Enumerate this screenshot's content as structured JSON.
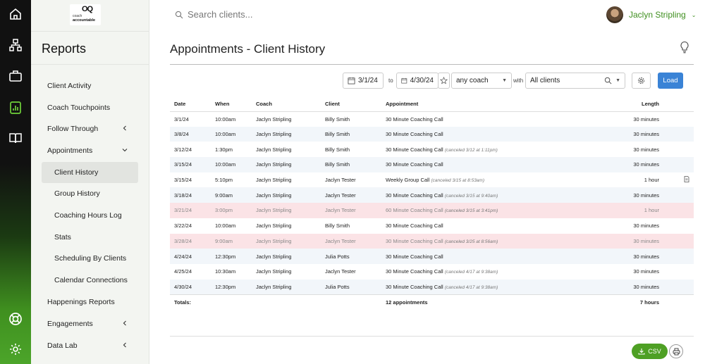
{
  "rail": {
    "icons": [
      "home-icon",
      "sitemap-icon",
      "briefcase-icon",
      "report-icon",
      "book-icon",
      "lifebuoy-icon",
      "gear-icon"
    ]
  },
  "logo": {
    "mark": "OQ",
    "line1": "coach",
    "line2": "accountable"
  },
  "sidebar": {
    "title": "Reports",
    "items": [
      {
        "label": "Client Activity"
      },
      {
        "label": "Coach Touchpoints"
      },
      {
        "label": "Follow Through"
      },
      {
        "label": "Appointments"
      },
      {
        "label": "Client History"
      },
      {
        "label": "Group History"
      },
      {
        "label": "Coaching Hours Log"
      },
      {
        "label": "Stats"
      },
      {
        "label": "Scheduling By Clients"
      },
      {
        "label": "Calendar Connections"
      },
      {
        "label": "Happenings Reports"
      },
      {
        "label": "Engagements"
      },
      {
        "label": "Data Lab"
      }
    ]
  },
  "header": {
    "search_placeholder": "Search clients...",
    "user_name": "Jaclyn Stripling"
  },
  "page_title": "Appointments - Client History",
  "filters": {
    "start_date": "3/1/24",
    "to_label": "to",
    "end_date": "4/30/24",
    "coach": "any coach",
    "with_label": "with",
    "clients": "All clients",
    "load_label": "Load"
  },
  "table": {
    "headers": [
      "Date",
      "When",
      "Coach",
      "Client",
      "Appointment",
      "Length"
    ],
    "rows": [
      {
        "date": "3/1/24",
        "when": "10:00am",
        "coach": "Jaclyn Stripling",
        "client": "Billy Smith",
        "appt": "30 Minute Coaching Call",
        "note": "",
        "length": "30 minutes"
      },
      {
        "date": "3/8/24",
        "when": "10:00am",
        "coach": "Jaclyn Stripling",
        "client": "Billy Smith",
        "appt": "30 Minute Coaching Call",
        "note": "",
        "length": "30 minutes"
      },
      {
        "date": "3/12/24",
        "when": "1:30pm",
        "coach": "Jaclyn Stripling",
        "client": "Billy Smith",
        "appt": "30 Minute Coaching Call",
        "note": "(canceled 3/12 at 1:11pm)",
        "length": "30 minutes"
      },
      {
        "date": "3/15/24",
        "when": "10:00am",
        "coach": "Jaclyn Stripling",
        "client": "Billy Smith",
        "appt": "30 Minute Coaching Call",
        "note": "",
        "length": "30 minutes"
      },
      {
        "date": "3/15/24",
        "when": "5:10pm",
        "coach": "Jaclyn Stripling",
        "client": "Jaclyn Tester",
        "appt": "Weekly Group Call",
        "note": "(canceled 3/15 at 8:53am)",
        "length": "1 hour"
      },
      {
        "date": "3/18/24",
        "when": "9:00am",
        "coach": "Jaclyn Stripling",
        "client": "Jaclyn Tester",
        "appt": "30 Minute Coaching Call",
        "note": "(canceled 3/15 at 9:40am)",
        "length": "30 minutes"
      },
      {
        "date": "3/21/24",
        "when": "3:00pm",
        "coach": "Jaclyn Stripling",
        "client": "Jaclyn Tester",
        "appt": "60 Minute Coaching Call",
        "note": "(canceled 3/15 at 3:41pm)",
        "length": "1 hour"
      },
      {
        "date": "3/22/24",
        "when": "10:00am",
        "coach": "Jaclyn Stripling",
        "client": "Billy Smith",
        "appt": "30 Minute Coaching Call",
        "note": "",
        "length": "30 minutes"
      },
      {
        "date": "3/28/24",
        "when": "9:00am",
        "coach": "Jaclyn Stripling",
        "client": "Jaclyn Tester",
        "appt": "30 Minute Coaching Call",
        "note": "(canceled 3/25 at 8:56am)",
        "length": "30 minutes"
      },
      {
        "date": "4/24/24",
        "when": "12:30pm",
        "coach": "Jaclyn Stripling",
        "client": "Julia Potts",
        "appt": "30 Minute Coaching Call",
        "note": "",
        "length": "30 minutes"
      },
      {
        "date": "4/25/24",
        "when": "10:30am",
        "coach": "Jaclyn Stripling",
        "client": "Jaclyn Tester",
        "appt": "30 Minute Coaching Call",
        "note": "(canceled 4/17 at 9:38am)",
        "length": "30 minutes"
      },
      {
        "date": "4/30/24",
        "when": "12:30pm",
        "coach": "Jaclyn Stripling",
        "client": "Julia Potts",
        "appt": "30 Minute Coaching Call",
        "note": "(canceled 4/17 at 9:38am)",
        "length": "30 minutes"
      }
    ],
    "totals": {
      "label": "Totals:",
      "appointments": "12 appointments",
      "length": "7 hours"
    }
  },
  "footer": {
    "csv_label": "CSV"
  },
  "colors": {
    "accent_green": "#4ea024",
    "load_blue": "#3a83d6",
    "cancel_row": "#fbe3e6"
  }
}
